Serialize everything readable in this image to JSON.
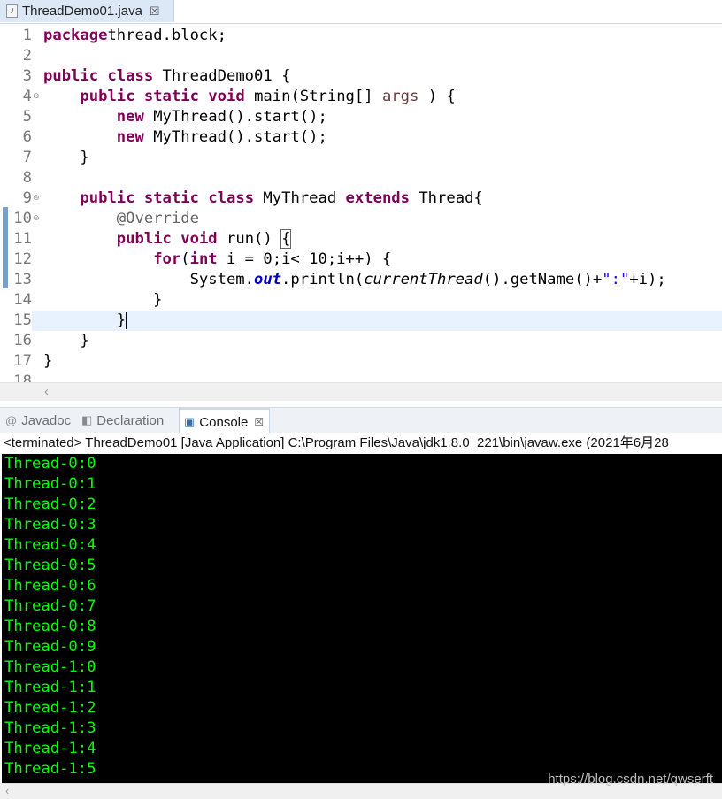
{
  "editor_tab": {
    "label": "ThreadDemo01.java",
    "close": "☒"
  },
  "code_lines": [
    {
      "n": "1",
      "tokens": [
        [
          "kw",
          "package"
        ],
        [
          "",
          "thread.block;"
        ]
      ]
    },
    {
      "n": "2",
      "tokens": []
    },
    {
      "n": "3",
      "tokens": [
        [
          "kw",
          "public"
        ],
        [
          "",
          " "
        ],
        [
          "kw",
          "class"
        ],
        [
          "",
          " ThreadDemo01 {"
        ]
      ]
    },
    {
      "n": "4",
      "fold": "⊖",
      "tokens": [
        [
          "",
          "    "
        ],
        [
          "kw",
          "public"
        ],
        [
          "",
          " "
        ],
        [
          "kw",
          "static"
        ],
        [
          "",
          " "
        ],
        [
          "kw",
          "void"
        ],
        [
          "",
          " main(String[] "
        ],
        [
          "param",
          "args"
        ],
        [
          "",
          " ) {"
        ]
      ]
    },
    {
      "n": "5",
      "tokens": [
        [
          "",
          "        "
        ],
        [
          "kw",
          "new"
        ],
        [
          "",
          " MyThread().start();"
        ]
      ]
    },
    {
      "n": "6",
      "tokens": [
        [
          "",
          "        "
        ],
        [
          "kw",
          "new"
        ],
        [
          "",
          " MyThread().start();"
        ]
      ]
    },
    {
      "n": "7",
      "tokens": [
        [
          "",
          "    }"
        ]
      ]
    },
    {
      "n": "8",
      "tokens": []
    },
    {
      "n": "9",
      "fold": "⊖",
      "tokens": [
        [
          "",
          "    "
        ],
        [
          "kw",
          "public"
        ],
        [
          "",
          " "
        ],
        [
          "kw",
          "static"
        ],
        [
          "",
          " "
        ],
        [
          "kw",
          "class"
        ],
        [
          "",
          " MyThread "
        ],
        [
          "kw",
          "extends"
        ],
        [
          "",
          " Thread{"
        ]
      ]
    },
    {
      "n": "10",
      "fold": "⊖",
      "tokens": [
        [
          "",
          "        "
        ],
        [
          "ann",
          "@Override"
        ]
      ]
    },
    {
      "n": "11",
      "tokens": [
        [
          "",
          "        "
        ],
        [
          "kw",
          "public"
        ],
        [
          "",
          " "
        ],
        [
          "kw",
          "void"
        ],
        [
          "",
          " run() "
        ],
        [
          "bracebox",
          "{"
        ]
      ]
    },
    {
      "n": "12",
      "tokens": [
        [
          "",
          "            "
        ],
        [
          "kw",
          "for"
        ],
        [
          "",
          "("
        ],
        [
          "kw",
          "int"
        ],
        [
          "",
          " i = 0;i< 10;i++) {"
        ]
      ]
    },
    {
      "n": "13",
      "tokens": [
        [
          "",
          "                System."
        ],
        [
          "field",
          "out"
        ],
        [
          "",
          ".println("
        ],
        [
          "static",
          "currentThread"
        ],
        [
          "",
          "().getName()+"
        ],
        [
          "str",
          "\":\""
        ],
        [
          "",
          "+i);"
        ]
      ]
    },
    {
      "n": "14",
      "tokens": [
        [
          "",
          "            }"
        ]
      ]
    },
    {
      "n": "15",
      "current": true,
      "tokens": [
        [
          "",
          "        }"
        ],
        [
          "caret",
          ""
        ]
      ]
    },
    {
      "n": "16",
      "tokens": [
        [
          "",
          "    }"
        ]
      ]
    },
    {
      "n": "17",
      "tokens": [
        [
          "",
          "}"
        ]
      ]
    },
    {
      "n": "18",
      "tokens": []
    }
  ],
  "views": {
    "tabs": [
      {
        "label": "Javadoc",
        "icon": "@"
      },
      {
        "label": "Declaration",
        "icon": "◧"
      },
      {
        "label": "Console",
        "icon": "▣",
        "close": "☒"
      }
    ]
  },
  "console": {
    "status": "<terminated> ThreadDemo01 [Java Application] C:\\Program Files\\Java\\jdk1.8.0_221\\bin\\javaw.exe (2021年6月28",
    "lines": [
      "Thread-0:0",
      "Thread-0:1",
      "Thread-0:2",
      "Thread-0:3",
      "Thread-0:4",
      "Thread-0:5",
      "Thread-0:6",
      "Thread-0:7",
      "Thread-0:8",
      "Thread-0:9",
      "Thread-1:0",
      "Thread-1:1",
      "Thread-1:2",
      "Thread-1:3",
      "Thread-1:4",
      "Thread-1:5"
    ],
    "watermark": "https://blog.csdn.net/qwserft"
  },
  "colors": {
    "keyword": "#7f0055",
    "console_bg": "#000000",
    "console_fg": "#00ff00",
    "current_line": "#e8f2fe"
  }
}
